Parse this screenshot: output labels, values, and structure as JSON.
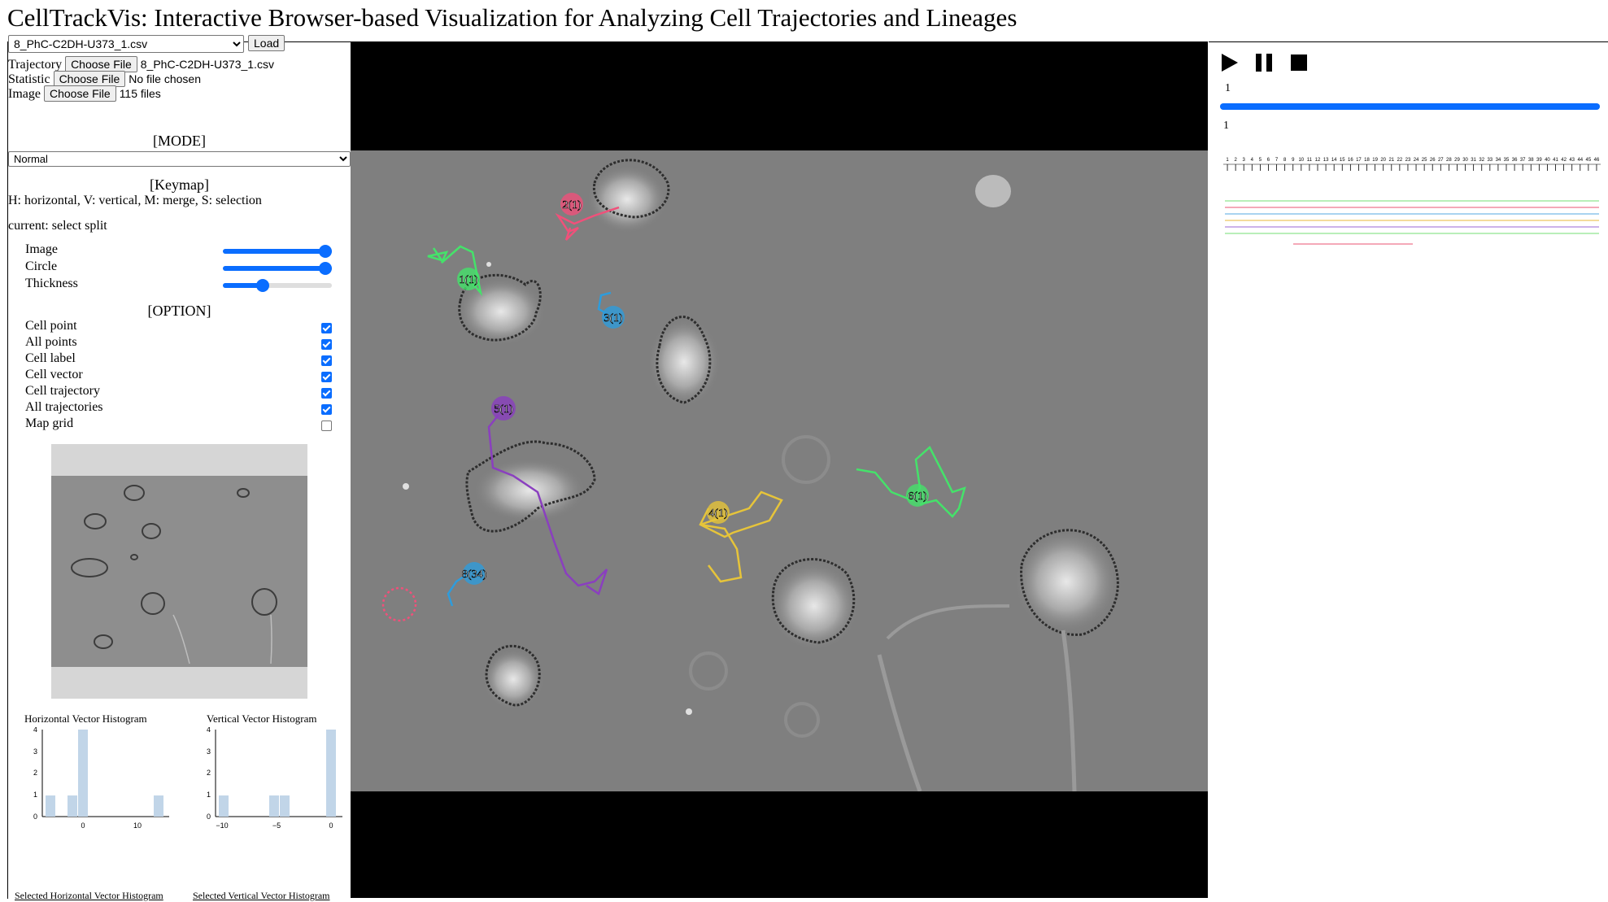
{
  "title": "CellTrackVis: Interactive Browser-based Visualization for Analyzing Cell Trajectories and Lineages",
  "file_select": {
    "value": "8_PhC-C2DH-U373_1.csv"
  },
  "load_button": "Load",
  "inputs": [
    {
      "label": "Trajectory",
      "button": "Choose File",
      "status": "8_PhC-C2DH-U373_1.csv"
    },
    {
      "label": "Statistic",
      "button": "Choose File",
      "status": "No file chosen"
    },
    {
      "label": "Image",
      "button": "Choose File",
      "status": "115 files"
    }
  ],
  "mode": {
    "header": "[MODE]",
    "value": "Normal"
  },
  "keymap": {
    "header": "[Keymap]",
    "text": "H: horizontal, V: vertical, M: merge, S: selection",
    "current": "current: select split"
  },
  "sliders": [
    {
      "label": "Image",
      "value": 1.0
    },
    {
      "label": "Circle",
      "value": 1.0
    },
    {
      "label": "Thickness",
      "value": 0.35
    }
  ],
  "options": {
    "header": "[OPTION]",
    "items": [
      {
        "label": "Cell point",
        "checked": true
      },
      {
        "label": "All points",
        "checked": true
      },
      {
        "label": "Cell label",
        "checked": true
      },
      {
        "label": "Cell vector",
        "checked": true
      },
      {
        "label": "Cell trajectory",
        "checked": true
      },
      {
        "label": "All trajectories",
        "checked": true
      },
      {
        "label": "Map grid",
        "checked": false
      }
    ]
  },
  "histograms": {
    "horizontal": {
      "title": "Horizontal Vector Histogram",
      "link": "Selected Horizontal Vector Histogram",
      "yticks": [
        "4",
        "3",
        "2",
        "1",
        "0"
      ],
      "xticks": [
        "0",
        "10"
      ]
    },
    "vertical": {
      "title": "Vertical Vector Histogram",
      "link": "Selected Vertical Vector Histogram",
      "yticks": [
        "4",
        "3",
        "2",
        "1",
        "0"
      ],
      "xticks": [
        "−10",
        "−5",
        "0"
      ]
    }
  },
  "cell_labels": [
    "1(1)",
    "2(1)",
    "3(1)",
    "5(1)",
    "4(1)",
    "6(1)",
    "8(34)"
  ],
  "timeline": {
    "frame_top": "1",
    "frame_bottom": "1",
    "progress": 1.0,
    "ticks_count": 46
  },
  "lineage_colors": [
    "#b9efb9",
    "#f4a9b8",
    "#a9d3f0",
    "#f4dc9c",
    "#cdb3ea",
    "#b9efb9",
    "#f4a9b8"
  ],
  "icons": {
    "play": "play-icon",
    "pause": "pause-icon",
    "stop": "stop-icon"
  }
}
